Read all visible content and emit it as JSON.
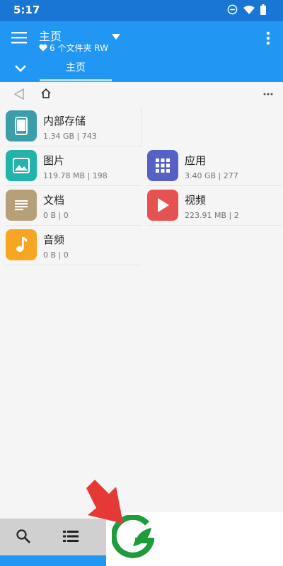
{
  "status": {
    "time": "5:17"
  },
  "appbar": {
    "title": "主页",
    "subtitle": "6 个文件夹 RW",
    "tab_label": "主页"
  },
  "items": [
    {
      "name": "内部存储",
      "meta": "1.34 GB | 743",
      "icon": "phone-icon",
      "color": "#3a9fa8"
    },
    {
      "name": "图片",
      "meta": "119.78 MB | 198",
      "icon": "image-icon",
      "color": "#23b3aa"
    },
    {
      "name": "应用",
      "meta": "3.40 GB | 277",
      "icon": "grid-icon",
      "color": "#5561c4"
    },
    {
      "name": "文档",
      "meta": "0 B | 0",
      "icon": "document-icon",
      "color": "#b5a07a"
    },
    {
      "name": "视频",
      "meta": "223.91 MB | 2",
      "icon": "play-icon",
      "color": "#e55252"
    },
    {
      "name": "音频",
      "meta": "0 B | 0",
      "icon": "music-note-icon",
      "color": "#f5a623"
    }
  ],
  "colors": {
    "status_bar": "#1976d2",
    "app_bar": "#2196f3",
    "tab_indicator": "#b3e5fc",
    "promo_arrow": "#e53935",
    "promo_logo": "#1e9b3a"
  }
}
